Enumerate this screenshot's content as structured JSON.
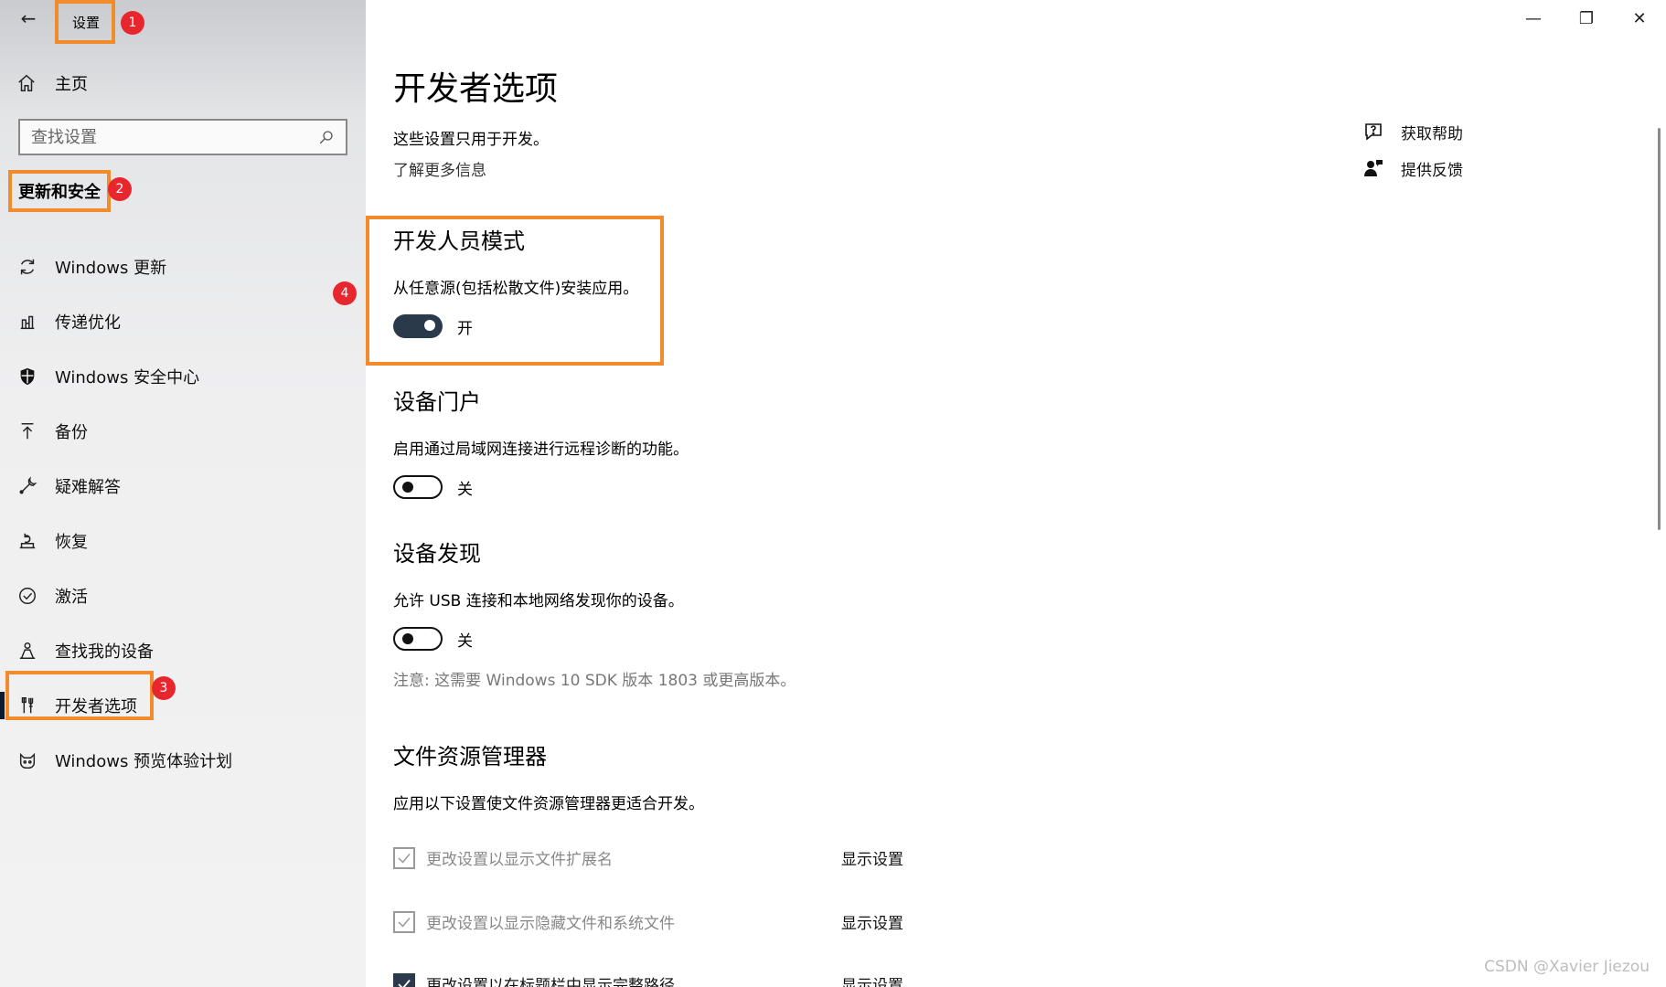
{
  "window": {
    "title": "设置",
    "controls": {
      "minimize": "—",
      "restore": "❐",
      "close": "✕"
    }
  },
  "sidebar": {
    "back_glyph": "←",
    "home_label": "主页",
    "search_placeholder": "查找设置",
    "section_title": "更新和安全",
    "items": [
      {
        "label": "Windows 更新",
        "icon": "sync-icon"
      },
      {
        "label": "传递优化",
        "icon": "delivery-optimization-icon"
      },
      {
        "label": "Windows 安全中心",
        "icon": "shield-icon"
      },
      {
        "label": "备份",
        "icon": "backup-arrow-icon"
      },
      {
        "label": "疑难解答",
        "icon": "wrench-icon"
      },
      {
        "label": "恢复",
        "icon": "recovery-icon"
      },
      {
        "label": "激活",
        "icon": "check-circle-icon"
      },
      {
        "label": "查找我的设备",
        "icon": "find-device-icon"
      },
      {
        "label": "开发者选项",
        "icon": "developer-tools-icon",
        "active": true
      },
      {
        "label": "Windows 预览体验计划",
        "icon": "insider-cat-icon"
      }
    ]
  },
  "annotations": {
    "badge1": "1",
    "badge2": "2",
    "badge3": "3",
    "badge4": "4"
  },
  "main": {
    "title": "开发者选项",
    "intro": "这些设置只用于开发。",
    "learn_more": "了解更多信息",
    "help": {
      "get_help": "获取帮助",
      "feedback": "提供反馈"
    },
    "developer_mode": {
      "title": "开发人员模式",
      "desc": "从任意源(包括松散文件)安装应用。",
      "state": "开",
      "on": true
    },
    "device_portal": {
      "title": "设备门户",
      "desc": "启用通过局域网连接进行远程诊断的功能。",
      "state": "关",
      "on": false
    },
    "device_discovery": {
      "title": "设备发现",
      "desc": "允许 USB 连接和本地网络发现你的设备。",
      "state": "关",
      "on": false
    },
    "note": "注意: 这需要 Windows 10 SDK 版本 1803 或更高版本。",
    "file_explorer": {
      "title": "文件资源管理器",
      "desc": "应用以下设置使文件资源管理器更适合开发。",
      "options": [
        {
          "label": "更改设置以显示文件扩展名",
          "action": "显示设置",
          "checked": true,
          "enabled": false
        },
        {
          "label": "更改设置以显示隐藏文件和系统文件",
          "action": "显示设置",
          "checked": true,
          "enabled": false
        },
        {
          "label": "更改设置以在标题栏中显示完整路径",
          "action": "显示设置",
          "checked": true,
          "enabled": true
        }
      ]
    }
  },
  "watermark": "CSDN @Xavier Jiezou",
  "colors": {
    "highlight": "#f28b2c",
    "badge": "#e8262d",
    "toggle_on": "#2b3a4a"
  }
}
